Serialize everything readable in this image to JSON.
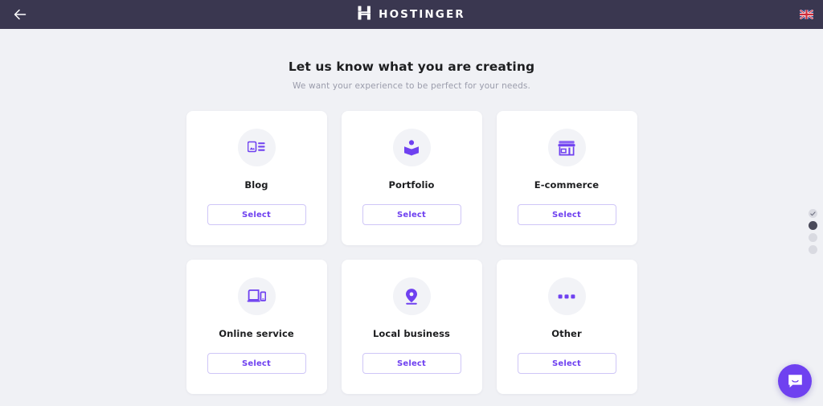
{
  "header": {
    "back_label": "Back",
    "back_icon": "arrow-left-icon",
    "brand_name": "HOSTINGER",
    "brand_icon": "hostinger-logo-icon",
    "language_flag": "uk-flag-icon"
  },
  "main": {
    "title": "Let us know what you are creating",
    "subtitle": "We want your experience to be perfect for your needs.",
    "cards": [
      {
        "id": "blog",
        "label": "Blog",
        "icon": "article-layout-icon",
        "select_label": "Select"
      },
      {
        "id": "portfolio",
        "label": "Portfolio",
        "icon": "portfolio-book-icon",
        "select_label": "Select"
      },
      {
        "id": "ecommerce",
        "label": "E-commerce",
        "icon": "storefront-icon",
        "select_label": "Select"
      },
      {
        "id": "online-service",
        "label": "Online service",
        "icon": "devices-icon",
        "select_label": "Select"
      },
      {
        "id": "local-business",
        "label": "Local business",
        "icon": "map-pin-icon",
        "select_label": "Select"
      },
      {
        "id": "other",
        "label": "Other",
        "icon": "ellipsis-icon",
        "select_label": "Select"
      }
    ]
  },
  "progress": {
    "steps": [
      {
        "state": "completed",
        "icon": "check-icon"
      },
      {
        "state": "active",
        "icon": ""
      },
      {
        "state": "upcoming",
        "icon": ""
      },
      {
        "state": "upcoming",
        "icon": ""
      }
    ]
  },
  "chat": {
    "icon": "chat-bubble-smile-icon",
    "label": "Open chat"
  },
  "colors": {
    "header_bg": "#3a3750",
    "page_bg": "#f0f1f5",
    "accent": "#6f41f0",
    "card_bg": "#ffffff",
    "icon_circle_bg": "#f2f3f7",
    "text_primary": "#1d1e20",
    "text_muted": "#9a9cab",
    "button_border": "#cfc6f7"
  }
}
